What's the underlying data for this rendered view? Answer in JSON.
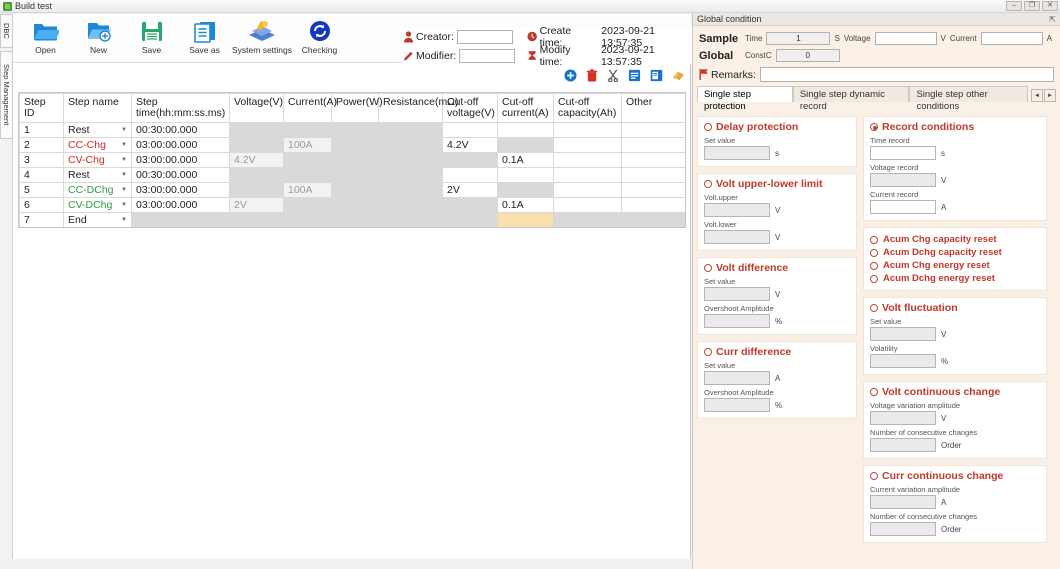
{
  "window": {
    "title": "Build test",
    "icon": "app-icon",
    "minimize": "–",
    "maximize": "❐",
    "close": "✕"
  },
  "vertical_tabs": [
    {
      "label": "DBC"
    },
    {
      "label": "Step Management"
    }
  ],
  "toolbar": {
    "buttons": [
      {
        "label": "Open",
        "icon": "folder-open-icon"
      },
      {
        "label": "New",
        "icon": "new-file-icon"
      },
      {
        "label": "Save",
        "icon": "save-disk-icon"
      },
      {
        "label": "Save as",
        "icon": "save-as-icon"
      },
      {
        "label": "System settings",
        "icon": "system-settings-icon"
      },
      {
        "label": "Checking",
        "icon": "refresh-check-icon"
      }
    ]
  },
  "meta": {
    "creator_label": "Creator:",
    "creator_value": "",
    "modifier_label": "Modifier:",
    "modifier_value": "",
    "create_time_label": "Create time:",
    "create_time_value": "2023-09-21 13:57:35",
    "modify_time_label": "Modify time:",
    "modify_time_value": "2023-09-21 13:57:35",
    "creator_icon": "person-icon",
    "modifier_icon": "pencil-icon",
    "create_time_icon": "clock-icon",
    "modify_time_icon": "hourglass-icon"
  },
  "editbar": {
    "icons": [
      {
        "name": "add-icon",
        "glyph": "✚",
        "color": "#1a73c8"
      },
      {
        "name": "delete-icon",
        "glyph": "🗑",
        "color": "#d93025"
      },
      {
        "name": "cut-icon",
        "glyph": "✂",
        "color": "#5a5a5a"
      },
      {
        "name": "copy-icon",
        "glyph": "▤",
        "color": "#1a73c8"
      },
      {
        "name": "paste-icon",
        "glyph": "▤",
        "color": "#1a73c8"
      },
      {
        "name": "import-icon",
        "glyph": "◤",
        "color": "#e8a33d"
      }
    ]
  },
  "table": {
    "columns": [
      "Step ID",
      "Step name",
      "Step time(hh:mm:ss.ms)",
      "Voltage(V)",
      "Current(A)",
      "Power(W)",
      "Resistance(mΩ)",
      "Cut-off voltage(V)",
      "Cut-off current(A)",
      "Cut-off capacity(Ah)",
      "Other"
    ],
    "rows": [
      {
        "id": "1",
        "name": "Rest",
        "name_color": "normal",
        "time": "00:30:00.000",
        "time_state": "edit",
        "voltage": "",
        "voltage_state": "disabled",
        "current": "",
        "current_state": "disabled",
        "power": "",
        "power_state": "disabled",
        "resistance": "",
        "resistance_state": "disabled",
        "cut_voltage": "",
        "cut_voltage_state": "edit",
        "cut_current": "",
        "cut_current_state": "edit",
        "cut_capacity": "",
        "cut_capacity_state": "edit",
        "other": "",
        "other_state": "edit"
      },
      {
        "id": "2",
        "name": "CC-Chg",
        "name_color": "red",
        "time": "03:00:00.000",
        "time_state": "edit",
        "voltage": "",
        "voltage_state": "disabled",
        "current": "100A",
        "current_state": "soft",
        "power": "",
        "power_state": "disabled",
        "resistance": "",
        "resistance_state": "disabled",
        "cut_voltage": "4.2V",
        "cut_voltage_state": "edit",
        "cut_current": "",
        "cut_current_state": "disabled",
        "cut_capacity": "",
        "cut_capacity_state": "edit",
        "other": "",
        "other_state": "edit"
      },
      {
        "id": "3",
        "name": "CV-Chg",
        "name_color": "red",
        "time": "03:00:00.000",
        "time_state": "edit",
        "voltage": "4.2V",
        "voltage_state": "soft",
        "current": "",
        "current_state": "disabled",
        "power": "",
        "power_state": "disabled",
        "resistance": "",
        "resistance_state": "disabled",
        "cut_voltage": "",
        "cut_voltage_state": "disabled",
        "cut_current": "0.1A",
        "cut_current_state": "edit",
        "cut_capacity": "",
        "cut_capacity_state": "edit",
        "other": "",
        "other_state": "edit"
      },
      {
        "id": "4",
        "name": "Rest",
        "name_color": "normal",
        "time": "00:30:00.000",
        "time_state": "edit",
        "voltage": "",
        "voltage_state": "disabled",
        "current": "",
        "current_state": "disabled",
        "power": "",
        "power_state": "disabled",
        "resistance": "",
        "resistance_state": "disabled",
        "cut_voltage": "",
        "cut_voltage_state": "edit",
        "cut_current": "",
        "cut_current_state": "edit",
        "cut_capacity": "",
        "cut_capacity_state": "edit",
        "other": "",
        "other_state": "edit"
      },
      {
        "id": "5",
        "name": "CC-DChg",
        "name_color": "green",
        "time": "03:00:00.000",
        "time_state": "edit",
        "voltage": "",
        "voltage_state": "disabled",
        "current": "100A",
        "current_state": "soft",
        "power": "",
        "power_state": "disabled",
        "resistance": "",
        "resistance_state": "disabled",
        "cut_voltage": "2V",
        "cut_voltage_state": "edit",
        "cut_current": "",
        "cut_current_state": "disabled",
        "cut_capacity": "",
        "cut_capacity_state": "edit",
        "other": "",
        "other_state": "edit"
      },
      {
        "id": "6",
        "name": "CV-DChg",
        "name_color": "green",
        "time": "03:00:00.000",
        "time_state": "edit",
        "voltage": "2V",
        "voltage_state": "soft",
        "current": "",
        "current_state": "disabled",
        "power": "",
        "power_state": "disabled",
        "resistance": "",
        "resistance_state": "disabled",
        "cut_voltage": "",
        "cut_voltage_state": "disabled",
        "cut_current": "0.1A",
        "cut_current_state": "edit",
        "cut_capacity": "",
        "cut_capacity_state": "edit",
        "other": "",
        "other_state": "edit"
      },
      {
        "id": "7",
        "name": "End",
        "name_color": "normal",
        "time": "",
        "time_state": "disabled",
        "voltage": "",
        "voltage_state": "disabled",
        "current": "",
        "current_state": "disabled",
        "power": "",
        "power_state": "disabled",
        "resistance": "",
        "resistance_state": "disabled",
        "cut_voltage": "",
        "cut_voltage_state": "disabled",
        "cut_current": "",
        "cut_current_state": "highlight",
        "cut_capacity": "",
        "cut_capacity_state": "disabled",
        "other": "",
        "other_state": "disabled"
      }
    ]
  },
  "right_panel": {
    "header_title": "Global condition",
    "pin_icon": "pin-icon",
    "sample": {
      "group_label": "Sample",
      "time_label": "Time",
      "time_value": "1",
      "time_unit": "S",
      "voltage_label": "Voltage",
      "voltage_value": "",
      "voltage_unit": "V",
      "current_label": "Current",
      "current_value": "",
      "current_unit": "A"
    },
    "global": {
      "group_label": "Global",
      "constc_label": "ConstC",
      "constc_value": "0"
    },
    "remarks": {
      "label": "Remarks:",
      "icon": "flag-icon",
      "value": ""
    },
    "tabs": [
      {
        "label": "Single step protection",
        "active": true
      },
      {
        "label": "Single step dynamic record",
        "active": false
      },
      {
        "label": "Single step other conditions",
        "active": false
      }
    ],
    "tab_nav": [
      {
        "glyph": "◄"
      },
      {
        "glyph": "►"
      }
    ],
    "left_column": [
      {
        "title": "Delay protection",
        "selected": false,
        "fields": [
          {
            "label": "Set value",
            "value": "",
            "unit": "s",
            "editable": false
          }
        ]
      },
      {
        "title": "Volt upper-lower limit",
        "selected": false,
        "fields": [
          {
            "label": "Volt.upper",
            "value": "",
            "unit": "V",
            "editable": false
          },
          {
            "label": "Volt.lower",
            "value": "",
            "unit": "V",
            "editable": false
          }
        ]
      },
      {
        "title": "Volt difference",
        "selected": false,
        "fields": [
          {
            "label": "Set value",
            "value": "",
            "unit": "V",
            "editable": false
          },
          {
            "label": "Overshoot Amplitude",
            "value": "",
            "unit": "%",
            "editable": false
          }
        ]
      },
      {
        "title": "Curr difference",
        "selected": false,
        "fields": [
          {
            "label": "Set value",
            "value": "",
            "unit": "A",
            "editable": false
          },
          {
            "label": "Overshoot Amplitude",
            "value": "",
            "unit": "%",
            "editable": false
          }
        ]
      }
    ],
    "right_column": [
      {
        "title": "Record conditions",
        "selected": true,
        "fields": [
          {
            "label": "Time record",
            "value": "",
            "unit": "s",
            "editable": true
          },
          {
            "label": "Voltage record",
            "value": "",
            "unit": "V",
            "editable": false
          },
          {
            "label": "Current record",
            "value": "",
            "unit": "A",
            "editable": true
          }
        ]
      }
    ],
    "reset_options": [
      {
        "label": "Acum Chg capacity reset",
        "selected": false
      },
      {
        "label": "Acum Dchg capacity reset",
        "selected": false
      },
      {
        "label": "Acum Chg energy reset",
        "selected": false
      },
      {
        "label": "Acum Dchg energy reset",
        "selected": false
      }
    ],
    "right_column2": [
      {
        "title": "Volt fluctuation",
        "selected": false,
        "fields": [
          {
            "label": "Set value",
            "value": "",
            "unit": "V",
            "editable": false
          },
          {
            "label": "Volatility",
            "value": "",
            "unit": "%",
            "editable": false
          }
        ]
      },
      {
        "title": "Volt continuous change",
        "selected": false,
        "fields": [
          {
            "label": "Voltage variation amplitude",
            "value": "",
            "unit": "V",
            "editable": false
          },
          {
            "label": "Number of consecutive changes",
            "value": "",
            "unit": "Order",
            "editable": false
          }
        ]
      },
      {
        "title": "Curr continuous change",
        "selected": false,
        "fields": [
          {
            "label": "Current variation amplitude",
            "value": "",
            "unit": "A",
            "editable": false
          },
          {
            "label": "Number of consecutive changes",
            "value": "",
            "unit": "Order",
            "editable": false
          }
        ]
      }
    ]
  },
  "colors": {
    "accent_red": "#c0392b",
    "chg_red": "#d62828",
    "dchg_green": "#2e9e44",
    "panel_bg": "#faf0e6",
    "highlight_cell": "#f9dfad"
  }
}
